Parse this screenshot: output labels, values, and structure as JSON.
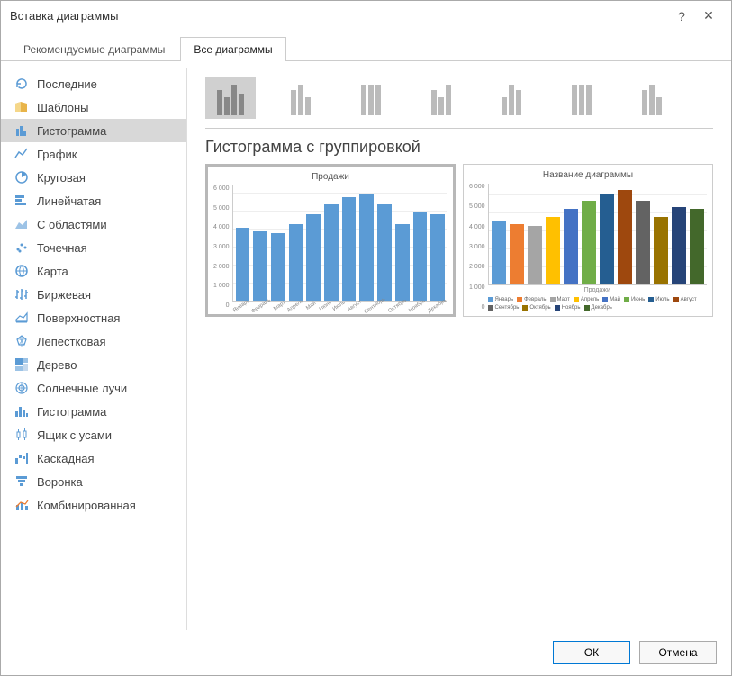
{
  "title": "Вставка диаграммы",
  "help": "?",
  "close": "✕",
  "tabs": {
    "recommended": "Рекомендуемые диаграммы",
    "all": "Все диаграммы"
  },
  "sidebar": [
    {
      "icon": "recent",
      "label": "Последние"
    },
    {
      "icon": "templates",
      "label": "Шаблоны"
    },
    {
      "icon": "column",
      "label": "Гистограмма",
      "selected": true
    },
    {
      "icon": "line",
      "label": "График"
    },
    {
      "icon": "pie",
      "label": "Круговая"
    },
    {
      "icon": "bar",
      "label": "Линейчатая"
    },
    {
      "icon": "area",
      "label": "С областями"
    },
    {
      "icon": "scatter",
      "label": "Точечная"
    },
    {
      "icon": "map",
      "label": "Карта"
    },
    {
      "icon": "stock",
      "label": "Биржевая"
    },
    {
      "icon": "surface",
      "label": "Поверхностная"
    },
    {
      "icon": "radar",
      "label": "Лепестковая"
    },
    {
      "icon": "tree",
      "label": "Дерево"
    },
    {
      "icon": "sunburst",
      "label": "Солнечные лучи"
    },
    {
      "icon": "histogram",
      "label": "Гистограмма"
    },
    {
      "icon": "box",
      "label": "Ящик с усами"
    },
    {
      "icon": "waterfall",
      "label": "Каскадная"
    },
    {
      "icon": "funnel",
      "label": "Воронка"
    },
    {
      "icon": "combo",
      "label": "Комбинированная"
    }
  ],
  "subtype_title": "Гистограмма с группировкой",
  "preview1": {
    "title": "Продажи"
  },
  "preview2": {
    "title": "Название диаграммы",
    "xlabel": "Продажи"
  },
  "chart_data": [
    {
      "type": "bar",
      "title": "Продажи",
      "ylabel": "",
      "ylim": [
        0,
        6000
      ],
      "yticks": [
        "6 000",
        "5 000",
        "4 000",
        "3 000",
        "2 000",
        "1 000",
        "0"
      ],
      "categories": [
        "Январь",
        "Февраль",
        "Март",
        "Апрель",
        "Май",
        "Июнь",
        "Июль",
        "Август",
        "Сентябрь",
        "Октябрь",
        "Ноябрь",
        "Декабрь"
      ],
      "values": [
        3800,
        3600,
        3500,
        4000,
        4500,
        5000,
        5400,
        5600,
        5000,
        4000,
        4600,
        4500
      ]
    },
    {
      "type": "bar",
      "title": "Название диаграммы",
      "xlabel": "Продажи",
      "ylim": [
        0,
        6000
      ],
      "yticks": [
        "6 000",
        "5 000",
        "4 000",
        "3 000",
        "2 000",
        "1 000",
        "0"
      ],
      "categories": [
        "Январь",
        "Февраль",
        "Март",
        "Апрель",
        "Май",
        "Июнь",
        "Июль",
        "Август",
        "Сентябрь",
        "Октябрь",
        "Ноябрь",
        "Декабрь"
      ],
      "values": [
        3800,
        3600,
        3500,
        4000,
        4500,
        5000,
        5400,
        5600,
        5000,
        4000,
        4600,
        4500
      ],
      "colors": [
        "#5b9bd5",
        "#ed7d31",
        "#a5a5a5",
        "#ffc000",
        "#4472c4",
        "#70ad47",
        "#255e91",
        "#9e480e",
        "#636363",
        "#997300",
        "#264478",
        "#43682b"
      ]
    }
  ],
  "buttons": {
    "ok": "ОК",
    "cancel": "Отмена"
  }
}
